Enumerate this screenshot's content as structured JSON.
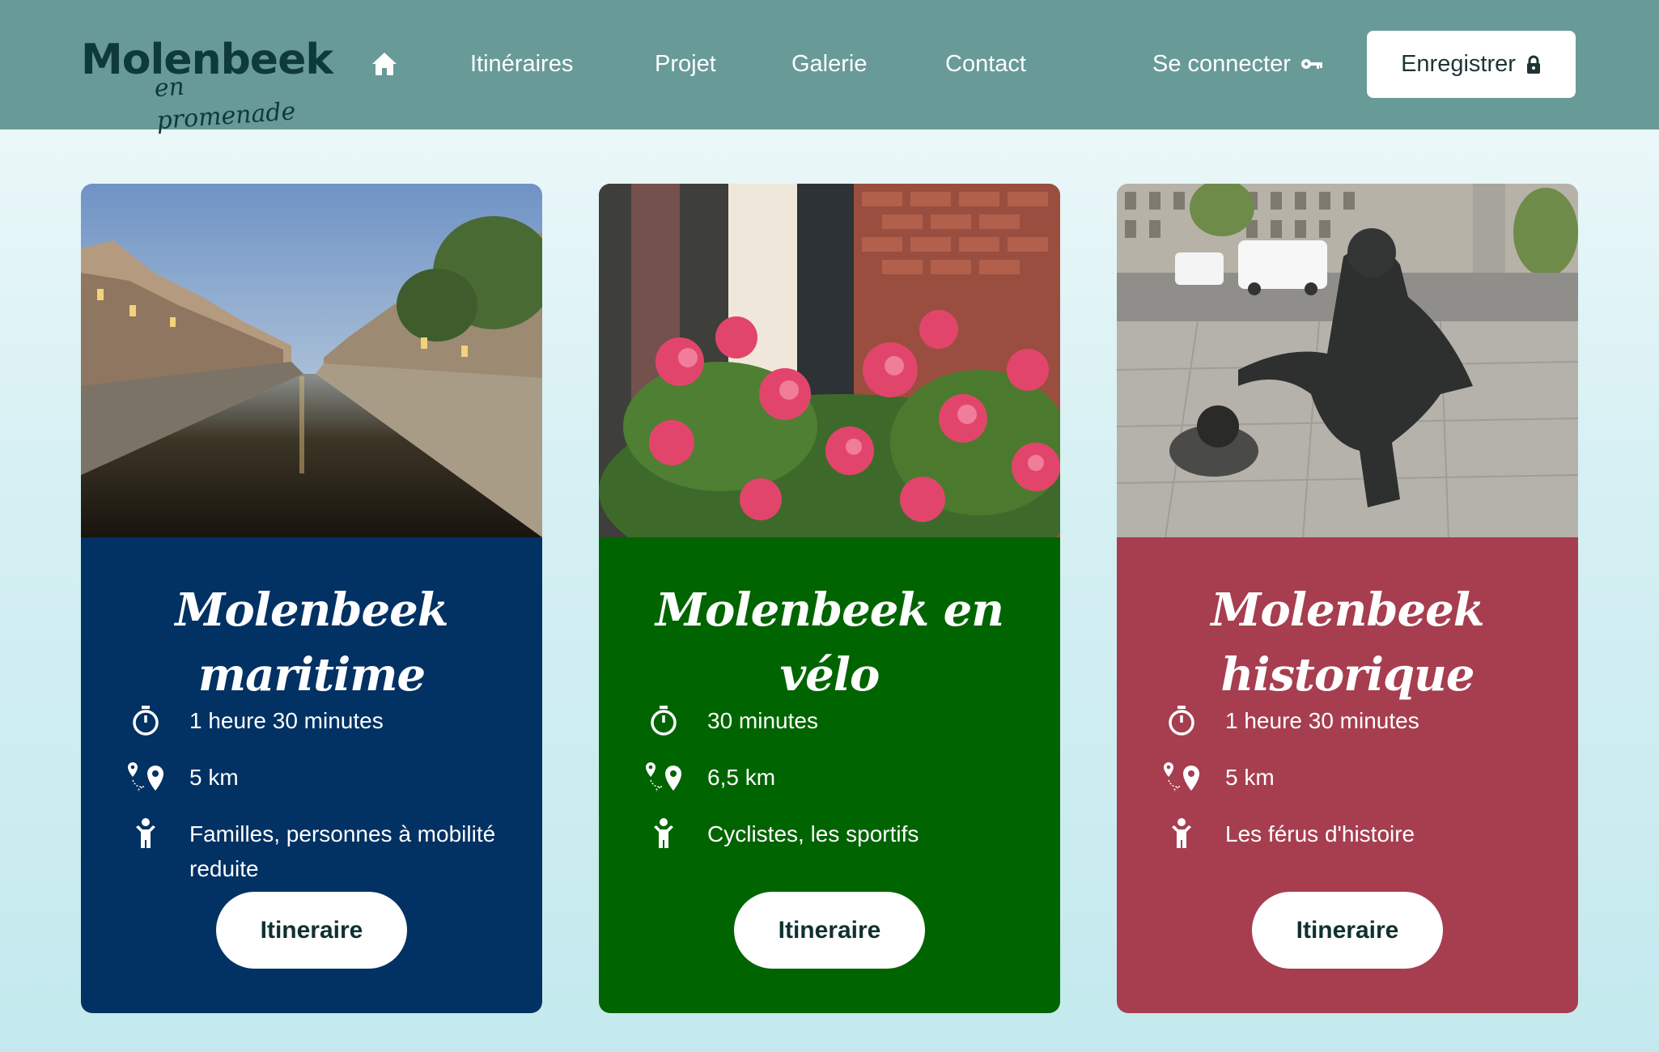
{
  "brand": {
    "main": "Molenbeek",
    "sub": "en promenade"
  },
  "nav": {
    "links": [
      "Itinéraires",
      "Projet",
      "Galerie",
      "Contact"
    ],
    "connect_label": "Se connecter",
    "register_label": "Enregistrer"
  },
  "colors": {
    "header_bg": "#689a98",
    "card_maritime": "#023163",
    "card_velo": "#006400",
    "card_historique": "#a63e50"
  },
  "icons": {
    "home": "home-icon",
    "key": "key-icon",
    "lock": "lock-icon",
    "duration": "stopwatch-icon",
    "distance": "map-pins-icon",
    "audience": "person-icon"
  },
  "cards": [
    {
      "title": "Molenbeek maritime",
      "duration": "1 heure 30 minutes",
      "distance": "5 km",
      "audience": "Familles, personnes à mobilité reduite",
      "button": "Itineraire"
    },
    {
      "title": "Molenbeek en vélo",
      "duration": "30 minutes",
      "distance": "6,5 km",
      "audience": "Cyclistes, les sportifs",
      "button": "Itineraire"
    },
    {
      "title": "Molenbeek historique",
      "duration": "1 heure 30 minutes",
      "distance": "5 km",
      "audience": "Les férus d'histoire",
      "button": "Itineraire"
    }
  ]
}
